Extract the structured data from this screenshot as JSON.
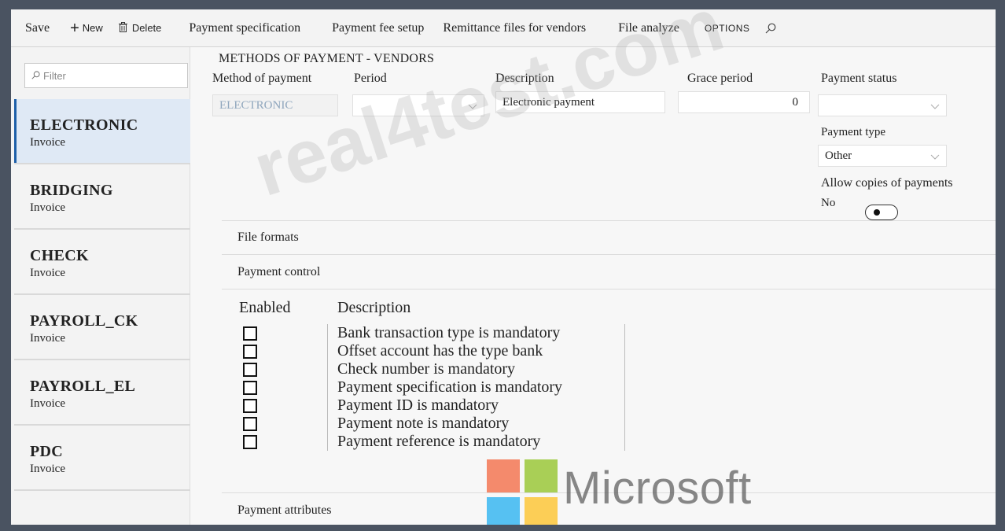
{
  "toolbar": {
    "save": "Save",
    "new": "New",
    "delete": "Delete",
    "links": [
      "Payment specification",
      "Payment fee setup",
      "Remittance files for vendors",
      "File analyze"
    ],
    "options": "OPTIONS"
  },
  "sidebar": {
    "filter_placeholder": "Filter",
    "items": [
      {
        "title": "ELECTRONIC",
        "sub": "Invoice",
        "active": true
      },
      {
        "title": "BRIDGING",
        "sub": "Invoice"
      },
      {
        "title": "CHECK",
        "sub": "Invoice"
      },
      {
        "title": "PAYROLL_CK",
        "sub": "Invoice"
      },
      {
        "title": "PAYROLL_EL",
        "sub": "Invoice"
      },
      {
        "title": "PDC",
        "sub": "Invoice"
      }
    ]
  },
  "form": {
    "section_title": "METHODS OF PAYMENT - VENDORS",
    "method_label": "Method of payment",
    "method_value": "ELECTRONIC",
    "period_label": "Period",
    "period_value": "",
    "description_label": "Description",
    "description_value": "Electronic payment",
    "grace_label": "Grace period",
    "grace_value": "0",
    "status_label": "Payment status",
    "status_value": "",
    "type_label": "Payment type",
    "type_value": "Other",
    "copies_label": "Allow copies of payments",
    "copies_value": "No"
  },
  "fasttabs": {
    "file_formats": "File formats",
    "payment_control": "Payment control",
    "payment_attributes": "Payment attributes"
  },
  "control_table": {
    "headers": [
      "Enabled",
      "Description"
    ],
    "rows": [
      "Bank transaction type is mandatory",
      "Offset account has the type bank",
      "Check number is mandatory",
      "Payment specification is mandatory",
      "Payment ID is mandatory",
      "Payment note is mandatory",
      "Payment reference is mandatory"
    ]
  },
  "overlay": {
    "watermark": "real4test.com",
    "brand": "Microsoft",
    "logo_colors": [
      "#f25022",
      "#7fba00",
      "#00a4ef",
      "#ffb900"
    ]
  }
}
